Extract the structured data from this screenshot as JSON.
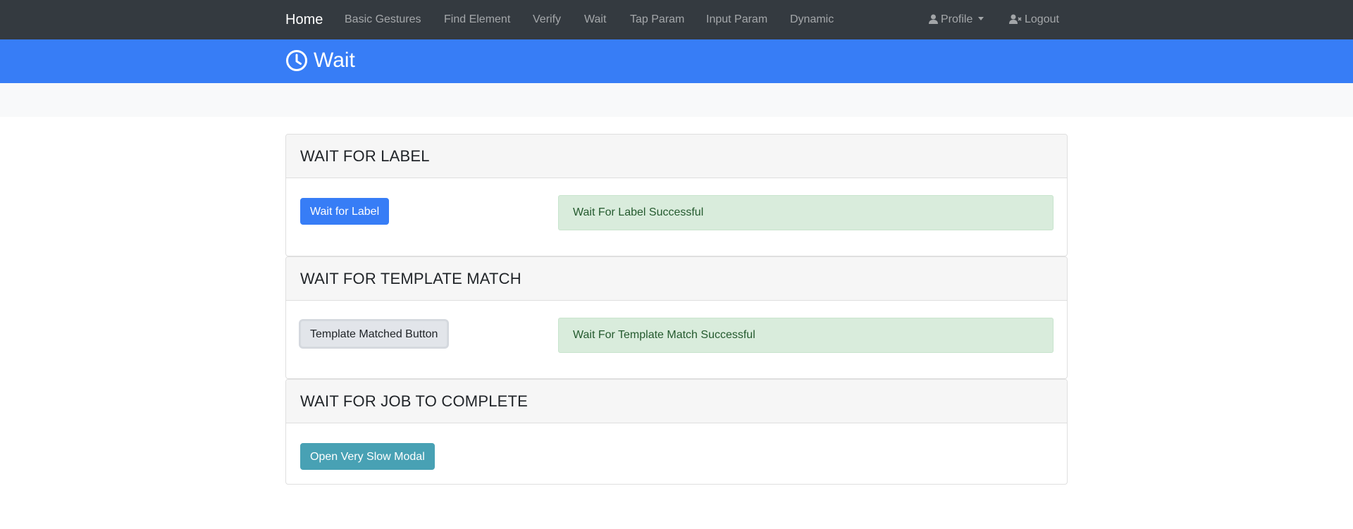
{
  "navbar": {
    "brand": "Home",
    "links": [
      "Basic Gestures",
      "Find Element",
      "Verify",
      "Wait",
      "Tap Param",
      "Input Param",
      "Dynamic"
    ],
    "profile": "Profile",
    "logout": "Logout"
  },
  "header": {
    "title": "Wait",
    "icon": "clock-icon"
  },
  "sections": [
    {
      "title": "WAIT FOR LABEL",
      "button": "Wait for Label",
      "status": "Wait For Label Successful"
    },
    {
      "title": "WAIT FOR TEMPLATE MATCH",
      "button": "Template Matched Button",
      "status": "Wait For Template Match Successful"
    },
    {
      "title": "WAIT FOR JOB TO COMPLETE",
      "button": "Open Very Slow Modal"
    }
  ],
  "colors": {
    "navbar": "#343a40",
    "header": "#377df6",
    "primary": "#377df6",
    "info": "#48a1b4",
    "success_bg": "#d9ecdc"
  }
}
